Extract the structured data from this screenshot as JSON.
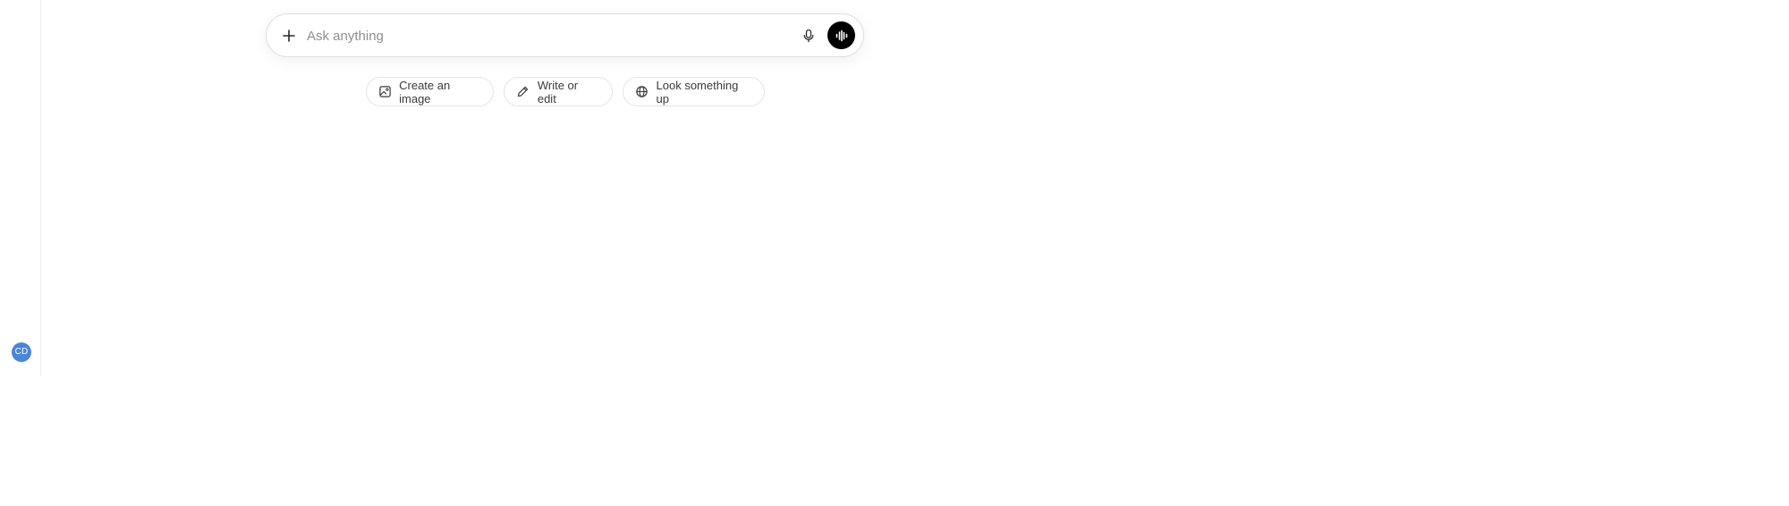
{
  "sidebar": {
    "avatar_initials": "CD",
    "avatar_color": "#4a86d9"
  },
  "composer": {
    "placeholder": "Ask anything",
    "value": "",
    "icons": {
      "add": "plus-icon",
      "dictate": "microphone-icon",
      "voice": "voice-waveform-icon"
    }
  },
  "suggestions": [
    {
      "label": "Create an image",
      "icon": "image-icon"
    },
    {
      "label": "Write or edit",
      "icon": "pencil-icon"
    },
    {
      "label": "Look something up",
      "icon": "globe-icon"
    }
  ]
}
